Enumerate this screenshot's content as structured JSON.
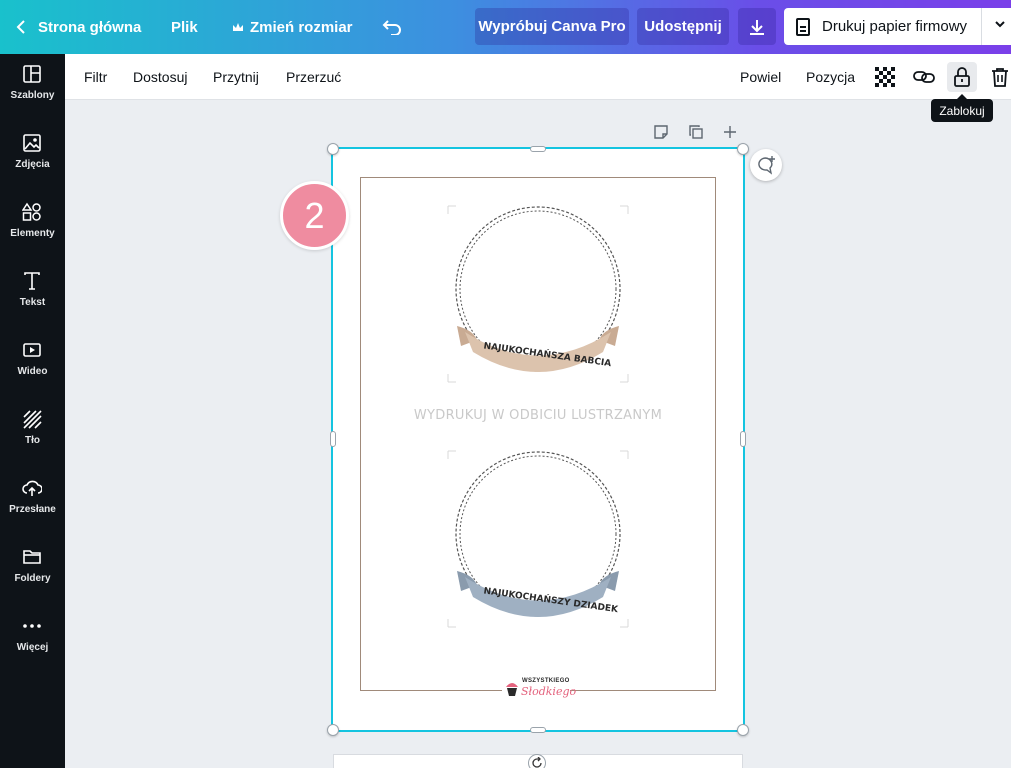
{
  "topbar": {
    "home": "Strona główna",
    "file": "Plik",
    "resize": "Zmień rozmiar",
    "try_pro": "Wypróbuj Canva Pro",
    "share": "Udostępnij",
    "print": "Drukuj papier firmowy"
  },
  "sidebar": {
    "items": [
      {
        "label": "Szablony",
        "icon": "templates-icon"
      },
      {
        "label": "Zdjęcia",
        "icon": "photos-icon"
      },
      {
        "label": "Elementy",
        "icon": "elements-icon"
      },
      {
        "label": "Tekst",
        "icon": "text-icon"
      },
      {
        "label": "Wideo",
        "icon": "video-icon"
      },
      {
        "label": "Tło",
        "icon": "background-icon"
      },
      {
        "label": "Przesłane",
        "icon": "upload-icon"
      },
      {
        "label": "Foldery",
        "icon": "folder-icon"
      },
      {
        "label": "Więcej",
        "icon": "more-icon"
      }
    ]
  },
  "toolbar": {
    "filter": "Filtr",
    "adjust": "Dostosuj",
    "crop": "Przytnij",
    "flip": "Przerzuć",
    "duplicate": "Powiel",
    "position": "Pozycja",
    "tooltip": "Zablokuj"
  },
  "canvas": {
    "badge": "2",
    "mirror_text": "WYDRUKUJ W ODBICIU LUSTRZANYM",
    "ribbon_top": "NAJUKOCHAŃSZA BABCIA",
    "ribbon_bottom": "NAJUKOCHAŃSZY DZIADEK",
    "logo_top": "WSZYSTKIEGO",
    "logo_bottom": "Słodkiego",
    "ribbon_top_color": "#dcc3ad",
    "ribbon_bottom_color": "#9fb0c2",
    "frame_color": "#a08a7a",
    "selection_color": "#14c4e0",
    "badge_color": "#ef8ca0"
  }
}
